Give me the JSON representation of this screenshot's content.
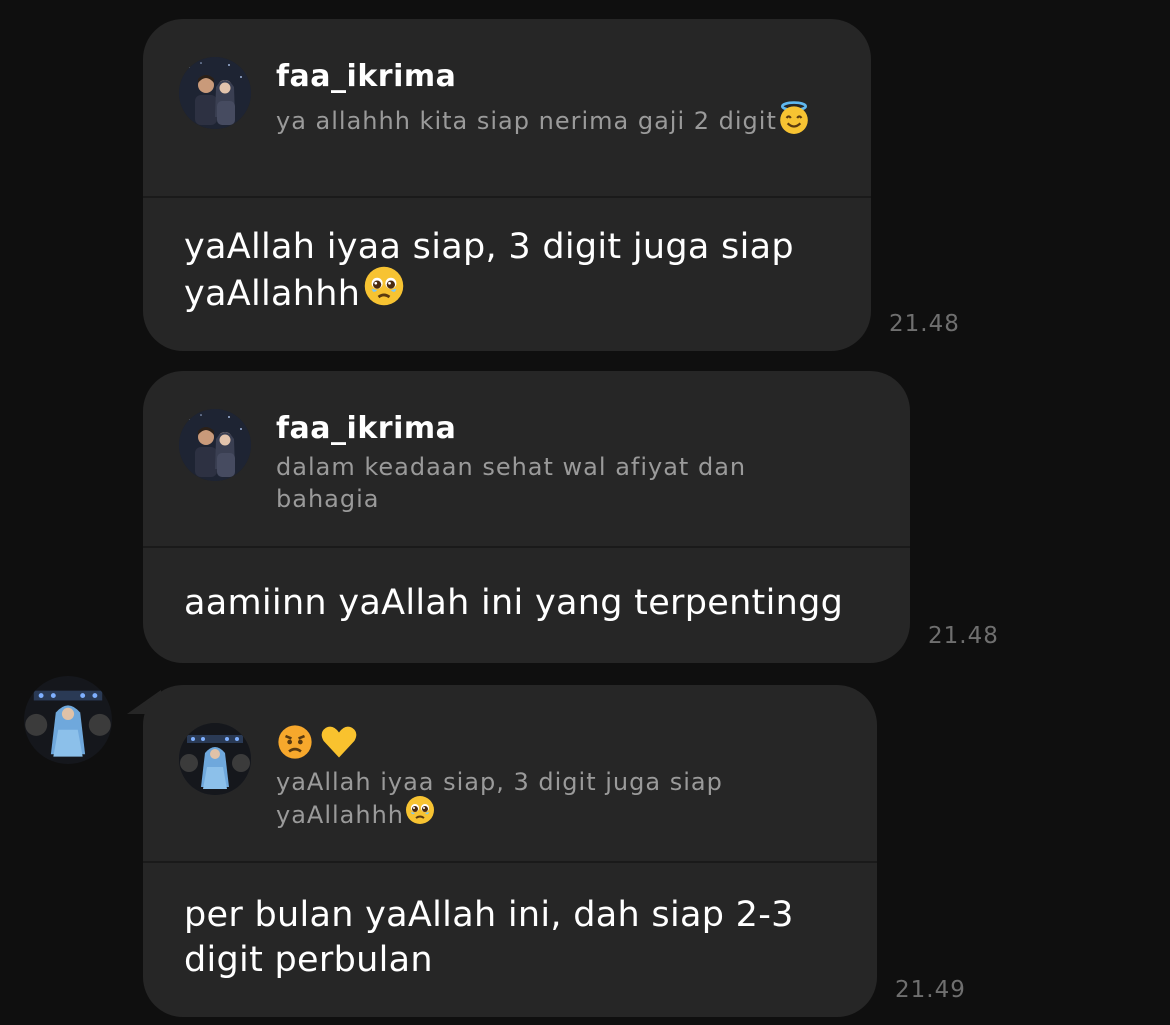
{
  "messages": [
    {
      "reply_author": "faa_ikrima",
      "reply_snippet": "ya allahhh kita siap nerima gaji 2 digit",
      "reply_emoji": "smiling-face-with-halo",
      "text_line1": "yaAllah iyaa siap, 3 digit juga siap",
      "text_line2": "yaAllahhh",
      "text_emoji": "face-holding-back-tears",
      "time": "21.48"
    },
    {
      "reply_author": "faa_ikrima",
      "reply_snippet_line1": "dalam keadaan sehat wal afiyat dan",
      "reply_snippet_line2": "bahagia",
      "text_line1": "aamiinn yaAllah ini yang terpentingg",
      "time": "21.48"
    },
    {
      "reply_reactions": [
        "angry-face",
        "yellow-heart"
      ],
      "reply_snippet_line1": "yaAllah iyaa siap, 3 digit juga siap",
      "reply_snippet_line2": "yaAllahhh",
      "reply_emoji": "face-holding-back-tears",
      "text_line1": "per bulan yaAllah ini, dah siap 2-3",
      "text_line2": "digit perbulan",
      "time": "21.49"
    }
  ],
  "colors": {
    "background": "#0f0f0f",
    "bubble": "#262626",
    "text": "#ffffff",
    "secondary_text": "#9a9a9a",
    "timestamp": "#6f6f6f"
  }
}
